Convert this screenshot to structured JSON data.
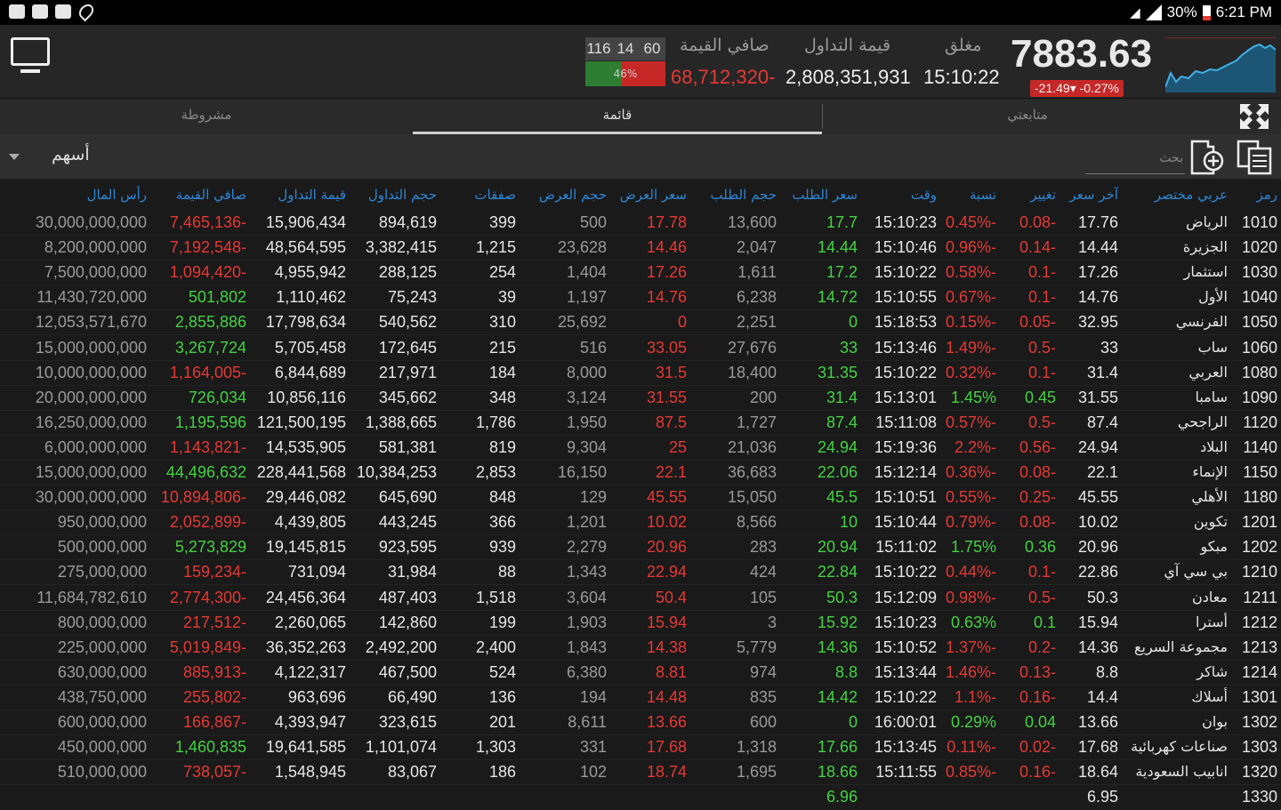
{
  "status_bar": {
    "battery": "30%",
    "time": "6:21 PM"
  },
  "header": {
    "index_value": "7883.63",
    "index_change": "-21.49▾ -0.27%",
    "status_label": "مغلق",
    "time": "15:10:22",
    "value_label": "قيمة التداول",
    "value": "2,808,351,931",
    "net_label": "صافي القيمة",
    "net_value": "68,712,320-",
    "counts": [
      "60",
      "14",
      "116"
    ],
    "ratio_text": "46%",
    "ratio_fraction": 0.46
  },
  "tabs": [
    "متابعتي",
    "قائمة",
    "مشروطة"
  ],
  "active_tab": "قائمة",
  "filter": {
    "label": "أسهم",
    "search_placeholder": "بحث"
  },
  "columns": [
    "رمز",
    "عربي مختصر",
    "آخر سعر",
    "تغيير",
    "نسبة",
    "وقت",
    "سعر الطلب",
    "حجم الطلب",
    "سعر العرض",
    "حجم العرض",
    "صفقات",
    "حجم التداول",
    "قيمة التداول",
    "صافي القيمة",
    "رأس المال"
  ],
  "rows": [
    [
      "1010",
      "الرياض",
      "17.76",
      "0.08-",
      "0.45%-",
      "15:10:23",
      "17.7",
      "13,600",
      "17.78",
      "500",
      "399",
      "894,619",
      "15,906,434",
      "7,465,136-",
      "30,000,000,000"
    ],
    [
      "1020",
      "الجزيرة",
      "14.44",
      "0.14-",
      "0.96%-",
      "15:10:46",
      "14.44",
      "2,047",
      "14.46",
      "23,628",
      "1,215",
      "3,382,415",
      "48,564,595",
      "7,192,548-",
      "8,200,000,000"
    ],
    [
      "1030",
      "استثمار",
      "17.26",
      "0.1-",
      "0.58%-",
      "15:10:22",
      "17.2",
      "1,611",
      "17.26",
      "1,404",
      "254",
      "288,125",
      "4,955,942",
      "1,094,420-",
      "7,500,000,000"
    ],
    [
      "1040",
      "الأول",
      "14.76",
      "0.1-",
      "0.67%-",
      "15:10:55",
      "14.72",
      "6,238",
      "14.76",
      "1,197",
      "39",
      "75,243",
      "1,110,462",
      "501,802",
      "11,430,720,000"
    ],
    [
      "1050",
      "الفرنسي",
      "32.95",
      "0.05-",
      "0.15%-",
      "15:18:53",
      "0",
      "2,251",
      "0",
      "25,692",
      "310",
      "540,562",
      "17,798,634",
      "2,855,886",
      "12,053,571,670"
    ],
    [
      "1060",
      "ساب",
      "33",
      "0.5-",
      "1.49%-",
      "15:13:46",
      "33",
      "27,676",
      "33.05",
      "516",
      "215",
      "172,645",
      "5,705,458",
      "3,267,724",
      "15,000,000,000"
    ],
    [
      "1080",
      "العربي",
      "31.4",
      "0.1-",
      "0.32%-",
      "15:10:22",
      "31.35",
      "18,400",
      "31.5",
      "8,000",
      "184",
      "217,971",
      "6,844,689",
      "1,164,005-",
      "10,000,000,000"
    ],
    [
      "1090",
      "سامبا",
      "31.55",
      "0.45",
      "1.45%",
      "15:13:01",
      "31.4",
      "200",
      "31.55",
      "3,124",
      "348",
      "345,662",
      "10,856,116",
      "726,034",
      "20,000,000,000"
    ],
    [
      "1120",
      "الراجحي",
      "87.4",
      "0.5-",
      "0.57%-",
      "15:11:08",
      "87.4",
      "1,727",
      "87.5",
      "1,950",
      "1,786",
      "1,388,665",
      "121,500,195",
      "1,195,596",
      "16,250,000,000"
    ],
    [
      "1140",
      "البلاد",
      "24.94",
      "0.56-",
      "2.2%-",
      "15:19:36",
      "24.94",
      "21,036",
      "25",
      "9,304",
      "819",
      "581,381",
      "14,535,905",
      "1,143,821-",
      "6,000,000,000"
    ],
    [
      "1150",
      "الإنماء",
      "22.1",
      "0.08-",
      "0.36%-",
      "15:12:14",
      "22.06",
      "36,683",
      "22.1",
      "16,150",
      "2,853",
      "10,384,253",
      "228,441,568",
      "44,496,632",
      "15,000,000,000"
    ],
    [
      "1180",
      "الأهلي",
      "45.55",
      "0.25-",
      "0.55%-",
      "15:10:51",
      "45.5",
      "15,050",
      "45.55",
      "129",
      "848",
      "645,690",
      "29,446,082",
      "10,894,806-",
      "30,000,000,000"
    ],
    [
      "1201",
      "تكوين",
      "10.02",
      "0.08-",
      "0.79%-",
      "15:10:44",
      "10",
      "8,566",
      "10.02",
      "1,201",
      "366",
      "443,245",
      "4,439,805",
      "2,052,899-",
      "950,000,000"
    ],
    [
      "1202",
      "مبكو",
      "20.96",
      "0.36",
      "1.75%",
      "15:11:02",
      "20.94",
      "283",
      "20.96",
      "2,279",
      "939",
      "923,595",
      "19,145,815",
      "5,273,829",
      "500,000,000"
    ],
    [
      "1210",
      "بي سي آي",
      "22.86",
      "0.1-",
      "0.44%-",
      "15:10:22",
      "22.84",
      "424",
      "22.94",
      "1,343",
      "88",
      "31,984",
      "731,094",
      "159,234-",
      "275,000,000"
    ],
    [
      "1211",
      "معادن",
      "50.3",
      "0.5-",
      "0.98%-",
      "15:12:09",
      "50.3",
      "105",
      "50.4",
      "3,604",
      "1,518",
      "487,403",
      "24,456,364",
      "2,774,300-",
      "11,684,782,610"
    ],
    [
      "1212",
      "أسترا",
      "15.94",
      "0.1",
      "0.63%",
      "15:10:23",
      "15.92",
      "3",
      "15.94",
      "1,903",
      "199",
      "142,860",
      "2,260,065",
      "217,512-",
      "800,000,000"
    ],
    [
      "1213",
      "مجموعة السريع",
      "14.36",
      "0.2-",
      "1.37%-",
      "15:10:52",
      "14.36",
      "5,779",
      "14.38",
      "1,843",
      "2,400",
      "2,492,200",
      "36,352,263",
      "5,019,849-",
      "225,000,000"
    ],
    [
      "1214",
      "شاكر",
      "8.8",
      "0.13-",
      "1.46%-",
      "15:13:44",
      "8.8",
      "974",
      "8.81",
      "6,380",
      "524",
      "467,500",
      "4,122,317",
      "885,913-",
      "630,000,000"
    ],
    [
      "1301",
      "أسلاك",
      "14.4",
      "0.16-",
      "1.1%-",
      "15:10:22",
      "14.42",
      "835",
      "14.48",
      "194",
      "136",
      "66,490",
      "963,696",
      "255,802-",
      "438,750,000"
    ],
    [
      "1302",
      "بوان",
      "13.66",
      "0.04",
      "0.29%",
      "16:00:01",
      "0",
      "600",
      "13.66",
      "8,611",
      "201",
      "323,615",
      "4,393,947",
      "166,867-",
      "600,000,000"
    ],
    [
      "1303",
      "صناعات كهربائية",
      "17.68",
      "0.02-",
      "0.11%-",
      "15:13:45",
      "17.66",
      "1,318",
      "17.68",
      "331",
      "1,303",
      "1,101,074",
      "19,641,585",
      "1,460,835",
      "450,000,000"
    ],
    [
      "1320",
      "انابيب السعودية",
      "18.64",
      "0.16-",
      "0.85%-",
      "15:11:55",
      "18.66",
      "1,695",
      "18.74",
      "102",
      "186",
      "83,067",
      "1,548,945",
      "738,057-",
      "510,000,000"
    ],
    [
      "1330",
      "",
      "6.95",
      "",
      "",
      "",
      "6.96",
      "",
      "",
      "",
      "",
      "",
      "",
      "",
      ""
    ]
  ],
  "colors": {
    "negative": "#e53935",
    "positive": "#43d243",
    "header_text": "#2f86d4",
    "background": "#1a1a1a"
  },
  "icons": [
    "monitor-icon",
    "expand-icon",
    "add-document-icon",
    "paste-icon",
    "dropdown-arrow-icon"
  ]
}
